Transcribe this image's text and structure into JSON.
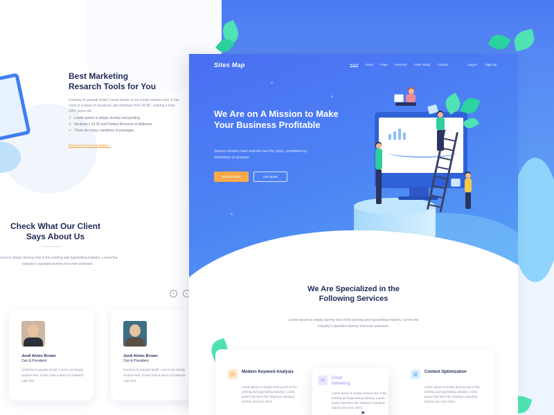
{
  "left_page": {
    "heading_line1": "Best Marketing",
    "heading_line2": "Resarch Tools for You",
    "description": "Contrary to popular belief, Lorem Ipsum is not simply random text. It has roots in a piece of classical Latin literature from 45 BC, making it over 2000 years old.",
    "checklist": [
      "Lorem Ipsum is simply dummy text printing",
      "Sections 1.10.32 and Finibus Bonorum et Malorum",
      "There are many variations of passages"
    ],
    "link": "Request FreeConsultation  ›",
    "testimonial_heading_line1": "Check What Our Client",
    "testimonial_heading_line2": "Says About Us",
    "testimonial_desc": "Ipsum is simply dummy text of the printing and typesetting industry. Lorem the industry's standard dummy text ever unknown.",
    "prev_arrow": "‹",
    "next_arrow": "›",
    "cards": [
      {
        "name": "Jordi Alvies Brown",
        "role": "Ceo & President",
        "quote": "Contrary to popular belief, Lorem not simply random text. It has roots a piece of classical Latin liter."
      },
      {
        "name": "Jordi Alvies Brown",
        "role": "Ceo & President",
        "quote": "Contrary to popular belief, Lorem not simply random text. It has roots a piece of classical Latin liter."
      }
    ]
  },
  "nav": {
    "logo": "Sites Map",
    "links": [
      "Home",
      "About",
      "Page",
      "Services",
      "Case Study",
      "Contact"
    ],
    "login": "Log In",
    "signup": "Sign Up"
  },
  "hero": {
    "title": "We Are on A Mission to Make Your Business Profitable",
    "subtitle": "Various versions have evolved over the years, sometimes by sometimes on purpose.",
    "primary_button": "Explore More",
    "secondary_button": "Get Quote"
  },
  "services": {
    "title_line1": "We Are Specialized in the",
    "title_line2": "Following Services",
    "description": "Lorem Ipsum is simply dummy text of the printing and typesetting industry. Lorem the industry's standard dummy text ever unknown.",
    "items": [
      {
        "name": "Modern Keyword Analysis",
        "icon": "document-icon",
        "text": "Lorem Ipsum is simply dummy text of the printing and typesetting industry. Lorem Ipsum has been the industry's standard dummy text ever since."
      },
      {
        "name": "Email Marketing",
        "icon": "email-icon",
        "text": "Lorem Ipsum is simply dummy text of the printing and typesetting industry. Lorem Ipsum has been the industry's standard dummy text ever since."
      },
      {
        "name": "Content Optimization",
        "icon": "content-icon",
        "text": "Lorem Ipsum is simply dummy text of the printing and typesetting industry. Lorem Ipsum has been the industry's standard dummy text ever since."
      }
    ]
  },
  "colors": {
    "primary_blue": "#4a78f0",
    "accent_orange": "#f7a94a",
    "heading_navy": "#1f2a56",
    "leaf_green": "#4fe3b4",
    "email_purple": "#a58bf7"
  }
}
